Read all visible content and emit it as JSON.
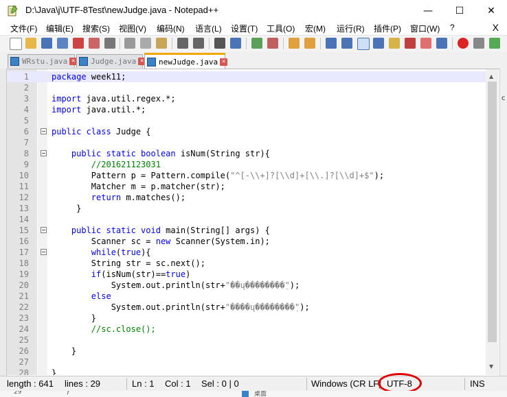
{
  "window": {
    "title": "D:\\Java\\j\\UTF-8Test\\newJudge.java - Notepad++",
    "minimize": "—",
    "maximize": "☐",
    "close": "✕"
  },
  "menu": {
    "items": [
      "文件(F)",
      "编辑(E)",
      "搜索(S)",
      "视图(V)",
      "编码(N)",
      "语言(L)",
      "设置(T)",
      "工具(O)",
      "宏(M)",
      "运行(R)",
      "插件(P)",
      "窗口(W)",
      "?"
    ],
    "close_label": "X"
  },
  "tabs": [
    {
      "label": "WRstu.java",
      "active": false
    },
    {
      "label": "Judge.java",
      "active": false
    },
    {
      "label": "newJudge.java",
      "active": true
    }
  ],
  "editor": {
    "lines": [
      "1",
      "2",
      "3",
      "4",
      "5",
      "6",
      "7",
      "8",
      "9",
      "10",
      "11",
      "12",
      "13",
      "14",
      "15",
      "16",
      "17",
      "18",
      "19",
      "20",
      "21",
      "22",
      "23",
      "24",
      "25",
      "26",
      "27",
      "28"
    ]
  },
  "status": {
    "length": "length : 641",
    "lines": "lines : 29",
    "ln": "Ln : 1",
    "col": "Col : 1",
    "sel": "Sel : 0 | 0",
    "eol": "Windows (CR LF)",
    "encoding": "UTF-8",
    "mode": "INS"
  },
  "background": {
    "left_fragment": "29",
    "left_fragment2": "}",
    "right_fragment": "桌面"
  },
  "colors": {
    "keyword": "#0000ff",
    "comment": "#008000",
    "string": "#808080",
    "current_line": "#e8e8ff",
    "annotation": "#e00000"
  }
}
